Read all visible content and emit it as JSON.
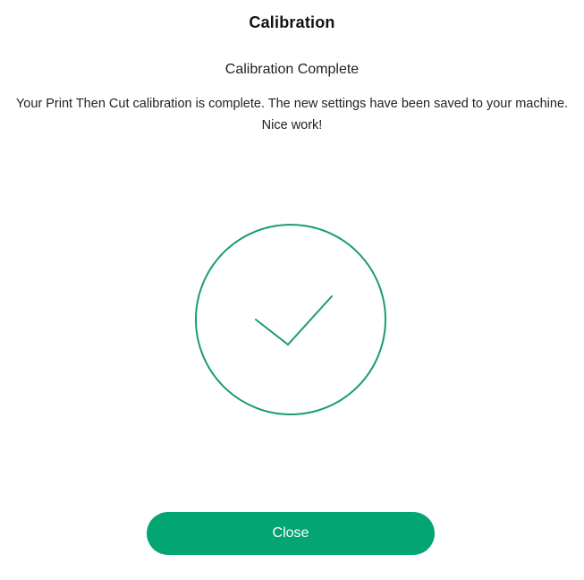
{
  "dialog": {
    "title": "Calibration",
    "subtitle": "Calibration Complete",
    "message": "Your Print Then Cut calibration is complete. The new settings have been saved to your machine. Nice work!",
    "success_icon": "check-circle-icon",
    "close_label": "Close"
  },
  "colors": {
    "accent": "#03a573",
    "icon_stroke": "#1a9a78",
    "text": "#222222"
  }
}
